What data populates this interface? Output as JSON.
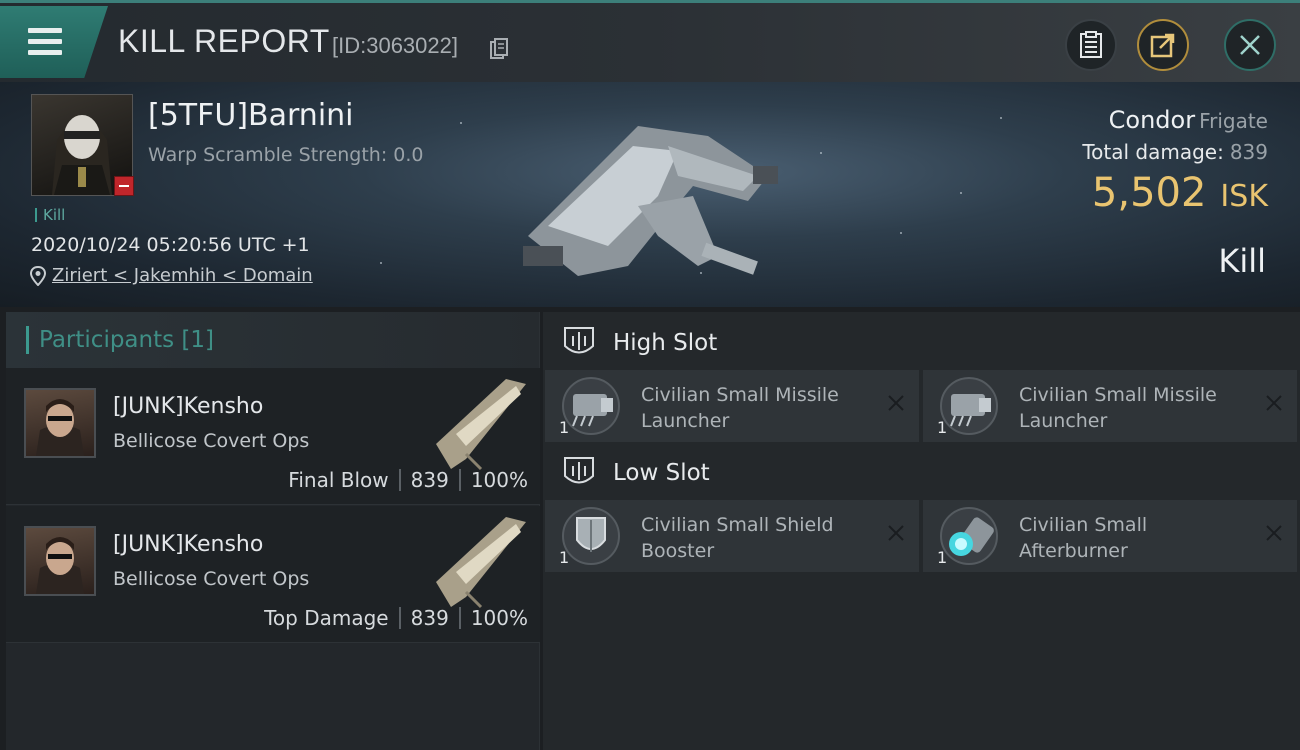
{
  "header": {
    "title": "KILL REPORT",
    "report_id": "[ID:3063022]",
    "icons": [
      "menu-icon",
      "copy-icon",
      "clipboard-icon",
      "share-icon",
      "close-icon"
    ]
  },
  "victim": {
    "name": "[5TFU]Barnini",
    "warp_scramble": "Warp Scramble Strength: 0.0",
    "tag": "Kill",
    "datetime": "2020/10/24 05:20:56 UTC +1",
    "location": "Ziriert < Jakemhih < Domain",
    "ship_name": "Condor",
    "ship_class": "Frigate",
    "total_damage_label": "Total damage:",
    "total_damage_value": "839",
    "isk_value": "5,502",
    "isk_unit": "ISK",
    "result": "Kill"
  },
  "participants": {
    "header": "Participants [1]",
    "rows": [
      {
        "name": "[JUNK]Kensho",
        "ship": "Bellicose Covert Ops",
        "role": "Final Blow",
        "damage": "839",
        "percent": "100%"
      },
      {
        "name": "[JUNK]Kensho",
        "ship": "Bellicose Covert Ops",
        "role": "Top Damage",
        "damage": "839",
        "percent": "100%"
      }
    ]
  },
  "slots": {
    "high": {
      "title": "High Slot",
      "modules": [
        {
          "name": "Civilian Small Missile Launcher",
          "count": "1",
          "icon": "missile-launcher-icon"
        },
        {
          "name": "Civilian Small Missile Launcher",
          "count": "1",
          "icon": "missile-launcher-icon"
        }
      ]
    },
    "low": {
      "title": "Low Slot",
      "modules": [
        {
          "name": "Civilian Small Shield Booster",
          "count": "1",
          "icon": "shield-booster-icon"
        },
        {
          "name": "Civilian Small Afterburner",
          "count": "1",
          "icon": "afterburner-icon"
        }
      ]
    }
  },
  "colors": {
    "accent_teal": "#3c9a8f",
    "isk_gold": "#e9c470",
    "loss_red": "#c0262b"
  }
}
